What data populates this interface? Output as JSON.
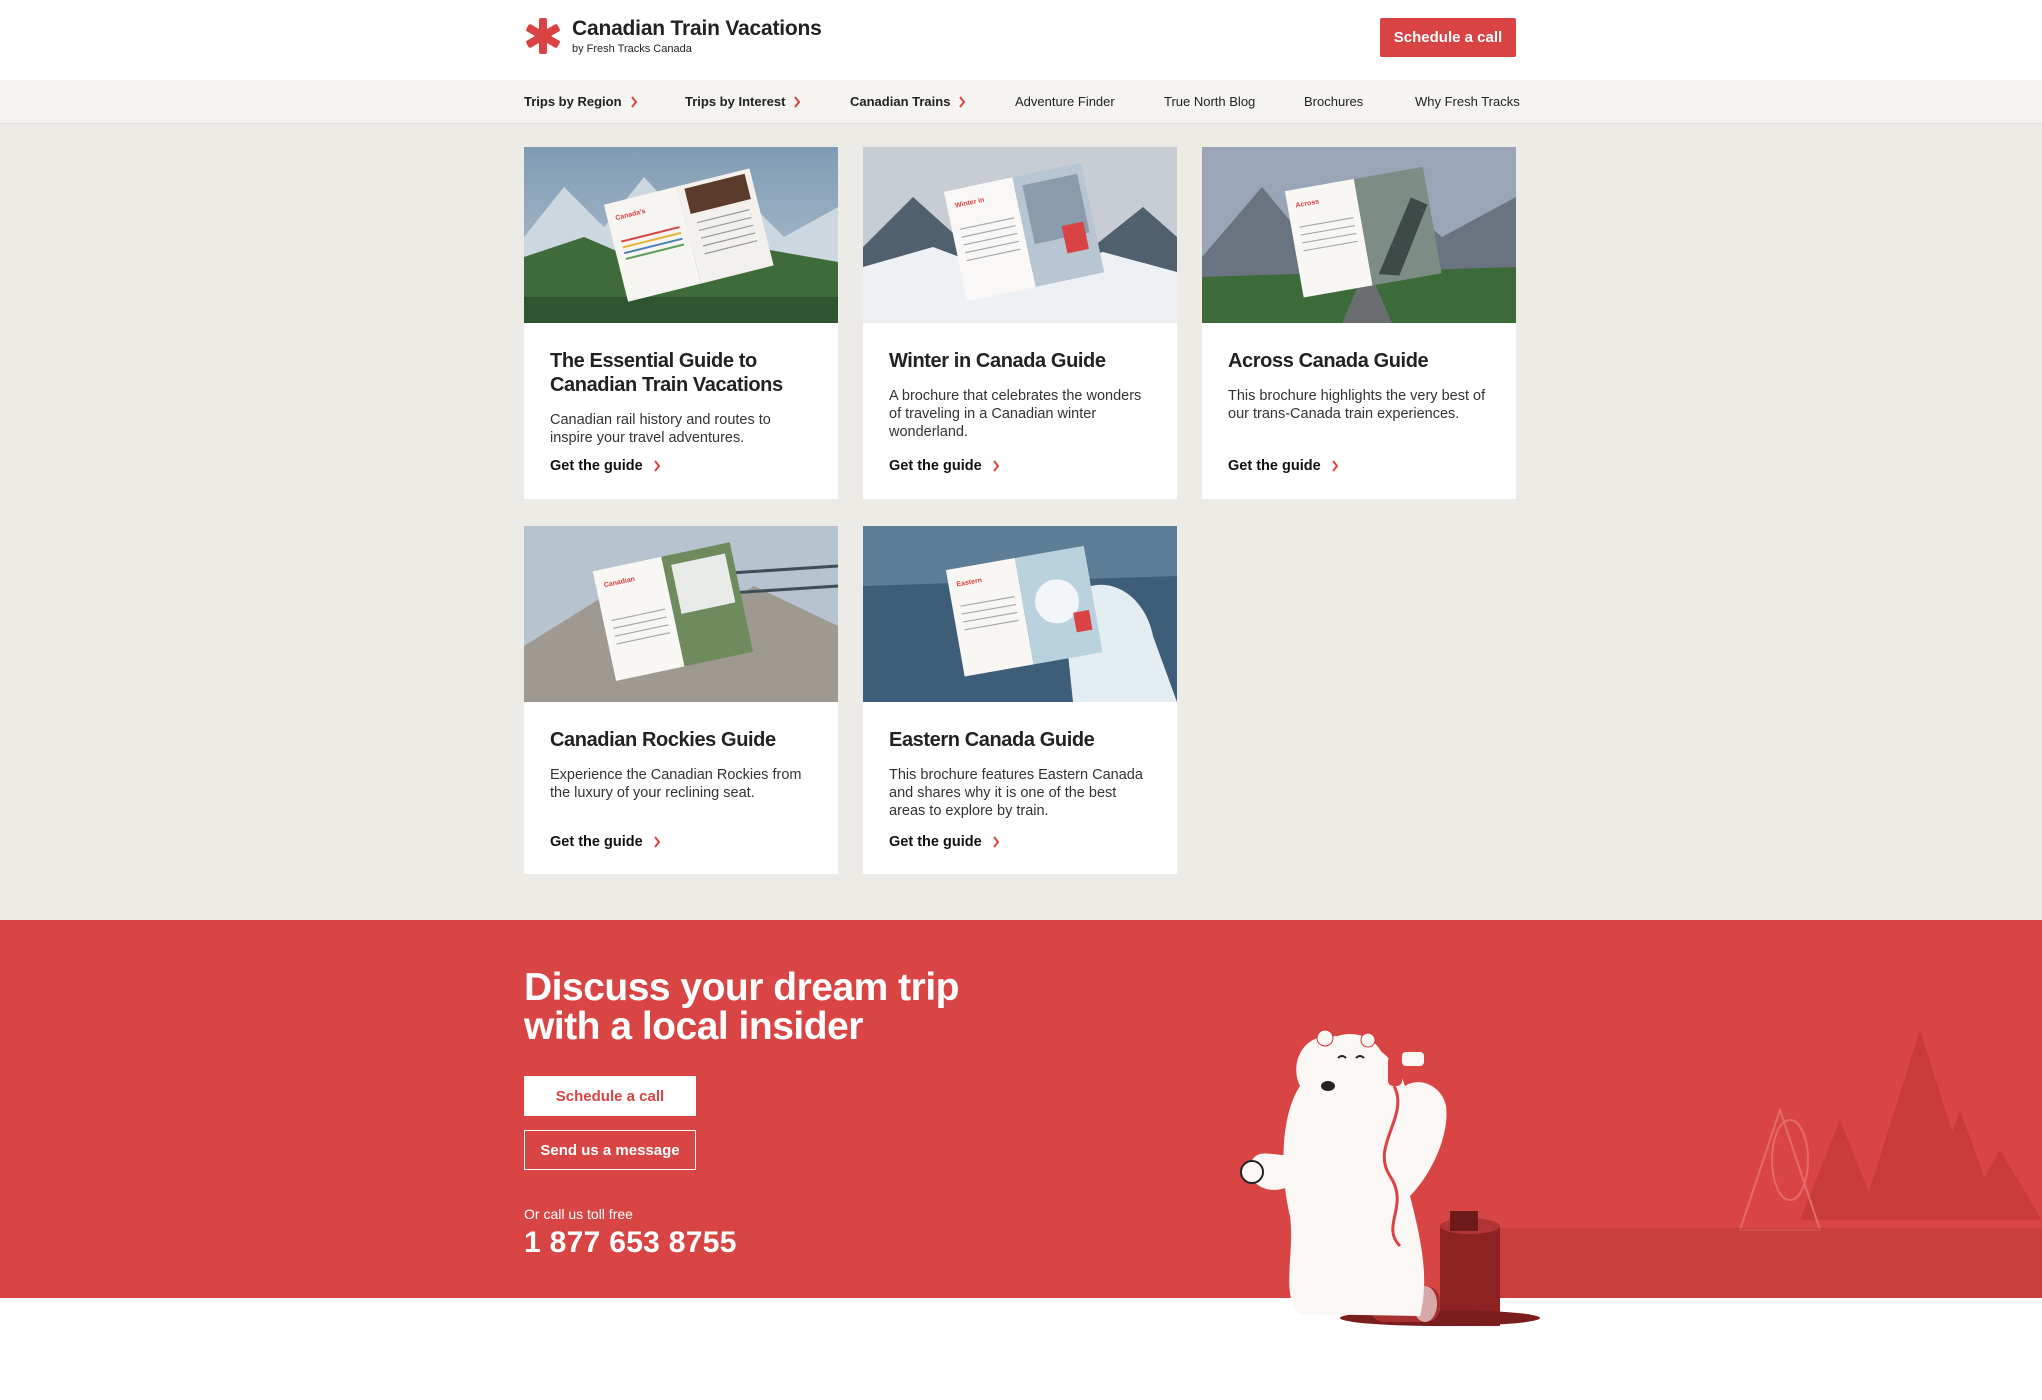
{
  "brand": {
    "title": "Canadian Train Vacations",
    "subtitle": "by Fresh Tracks Canada",
    "accent_color": "#d94343"
  },
  "header": {
    "schedule_label": "Schedule a call"
  },
  "nav": {
    "items": [
      {
        "label": "Trips by Region",
        "icon": "chevron-right-icon"
      },
      {
        "label": "Trips by Interest",
        "icon": "chevron-right-icon"
      },
      {
        "label": "Canadian Trains",
        "icon": "chevron-right-icon"
      },
      {
        "label": "Adventure Finder"
      },
      {
        "label": "True North Blog"
      },
      {
        "label": "Brochures"
      },
      {
        "label": "Why Fresh Tracks"
      }
    ]
  },
  "guides": [
    {
      "title": "The Essential Guide to Canadian Train Vacations",
      "description": "Canadian rail history and routes to inspire your travel adventures.",
      "link": "Get the guide"
    },
    {
      "title": "Winter in Canada Guide",
      "description": "A brochure that celebrates the wonders of traveling in a Canadian winter wonderland.",
      "link": "Get the guide"
    },
    {
      "title": "Across Canada Guide",
      "description": "This brochure highlights the very best of our trans-Canada train experiences.",
      "link": "Get the guide"
    },
    {
      "title": "Canadian Rockies Guide",
      "description": "Experience the Canadian Rockies from the luxury of your reclining seat.",
      "link": "Get the guide"
    },
    {
      "title": "Eastern Canada Guide",
      "description": "This brochure features Eastern Canada and shares why it is one of the best areas to explore by train.",
      "link": "Get the guide"
    }
  ],
  "cta": {
    "title_line1": "Discuss your dream trip",
    "title_line2": "with a local insider",
    "schedule_label": "Schedule a call",
    "message_label": "Send us a message",
    "toll_free_label": "Or call us toll free",
    "phone": "1 877 653 8755"
  }
}
